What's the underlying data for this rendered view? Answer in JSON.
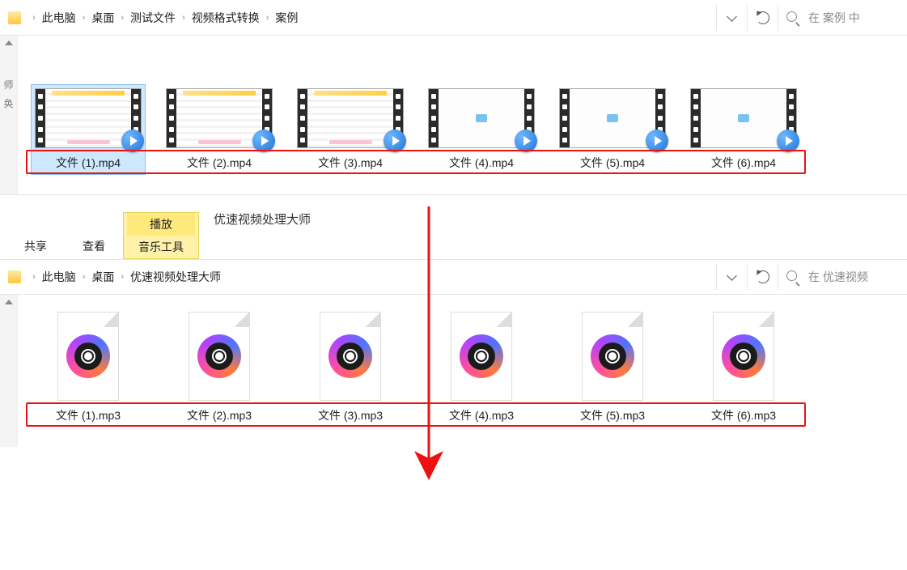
{
  "top": {
    "breadcrumbs": [
      "此电脑",
      "桌面",
      "测试文件",
      "视频格式转换",
      "案例"
    ],
    "search_placeholder": "在 案例 中",
    "left_gutter": [
      "师",
      "奂"
    ],
    "files": [
      {
        "label": "文件 (1).mp4",
        "kind": "detail",
        "selected": true
      },
      {
        "label": "文件 (2).mp4",
        "kind": "detail",
        "selected": false
      },
      {
        "label": "文件 (3).mp4",
        "kind": "detail",
        "selected": false
      },
      {
        "label": "文件 (4).mp4",
        "kind": "plain",
        "selected": false
      },
      {
        "label": "文件 (5).mp4",
        "kind": "plain",
        "selected": false
      },
      {
        "label": "文件 (6).mp4",
        "kind": "plain",
        "selected": false
      }
    ]
  },
  "ribbon": {
    "share": "共享",
    "view": "查看",
    "play": "播放",
    "music_tools": "音乐工具",
    "app_title": "优速视频处理大师"
  },
  "bottom": {
    "breadcrumbs": [
      "此电脑",
      "桌面",
      "优速视频处理大师"
    ],
    "search_placeholder": "在 优速视频",
    "files": [
      {
        "label": "文件 (1).mp3"
      },
      {
        "label": "文件 (2).mp3"
      },
      {
        "label": "文件 (3).mp3"
      },
      {
        "label": "文件 (4).mp3"
      },
      {
        "label": "文件 (5).mp3"
      },
      {
        "label": "文件 (6).mp3"
      }
    ]
  }
}
